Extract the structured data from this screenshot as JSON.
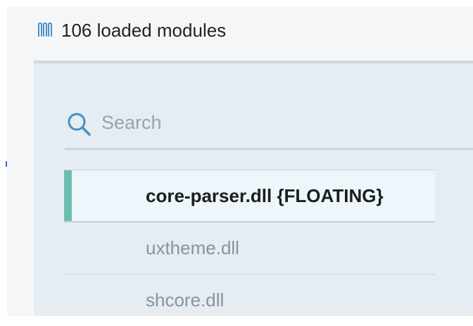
{
  "header": {
    "icon": "memory-icon",
    "title": "106 loaded modules"
  },
  "search": {
    "icon": "search-icon",
    "placeholder": "Search",
    "value": ""
  },
  "modules": [
    {
      "name": "core-parser.dll {FLOATING}",
      "selected": true
    },
    {
      "name": "uxtheme.dll",
      "selected": false
    },
    {
      "name": "shcore.dll",
      "selected": false
    }
  ],
  "colors": {
    "accent": "#6dbcb0",
    "icon": "#4a8fc4",
    "panel_background": "#e5edf2",
    "selected_background": "#edf6fa"
  }
}
